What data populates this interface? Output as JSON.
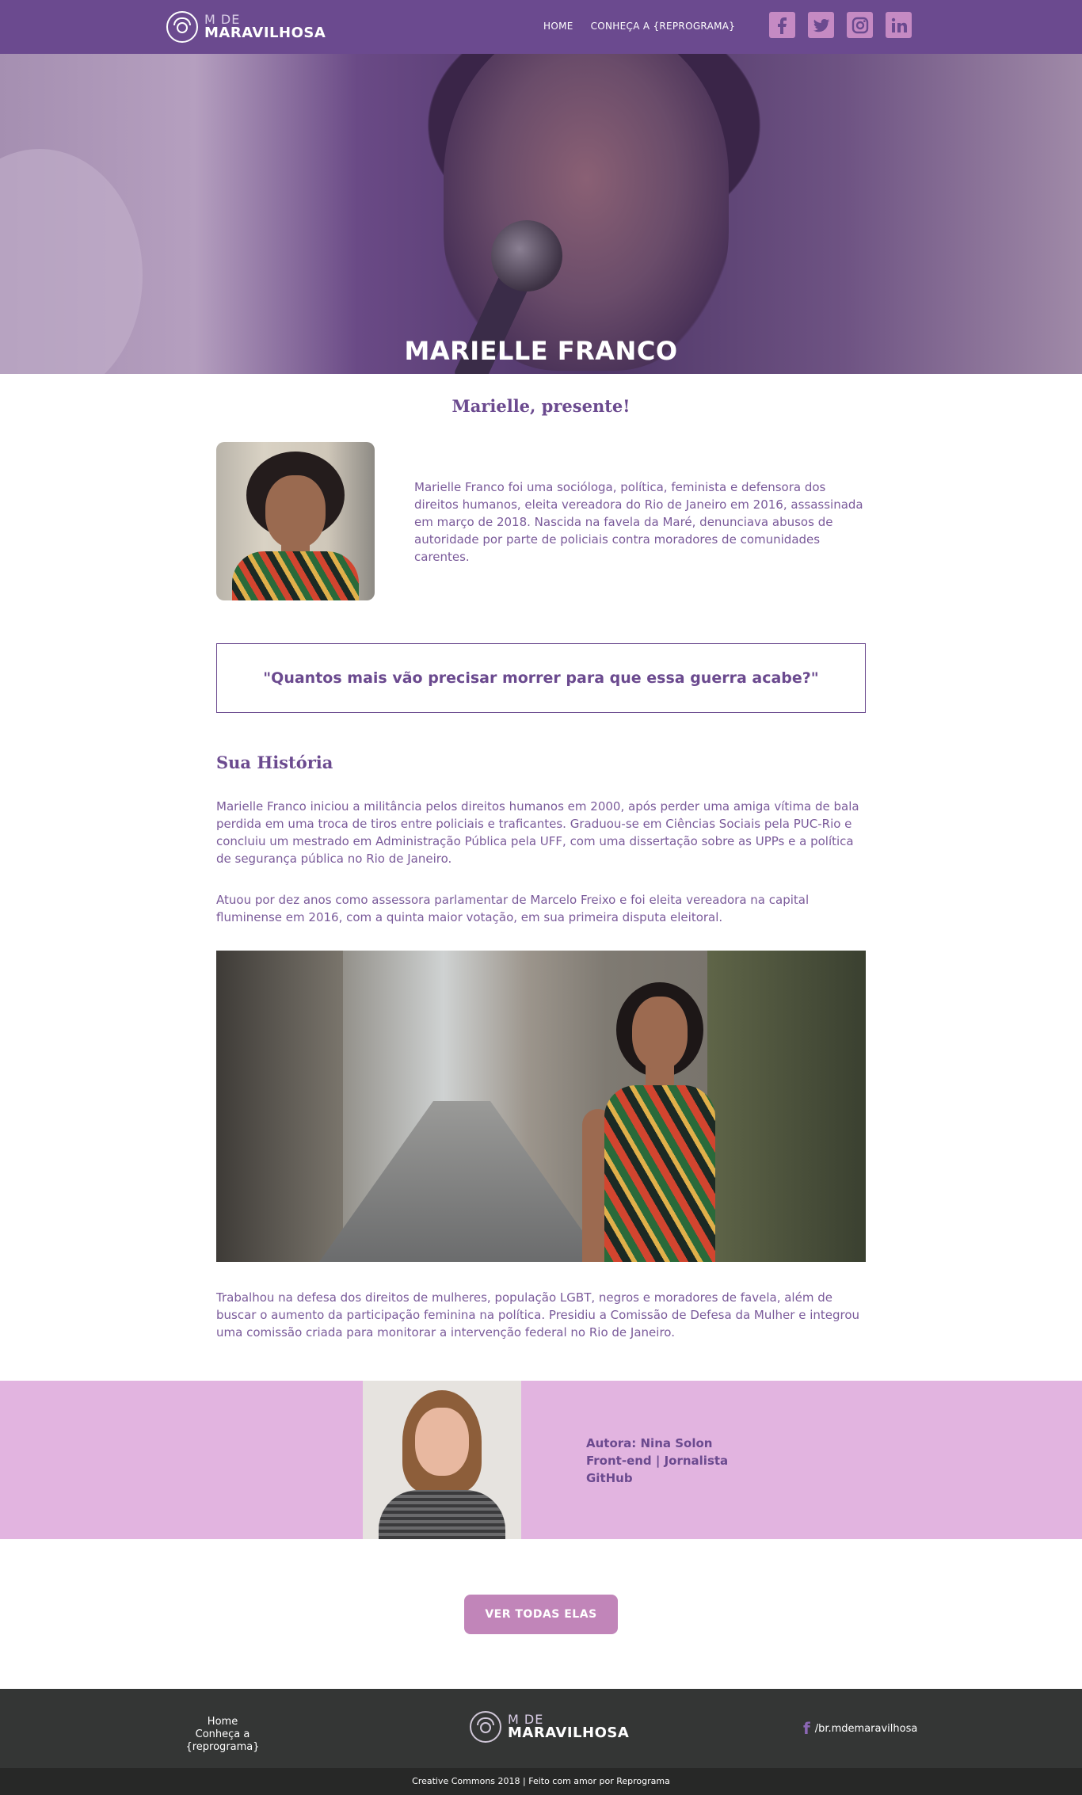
{
  "header": {
    "logo_small": "M DE",
    "logo_big": "MARAVILHOSA",
    "nav": [
      {
        "label": "HOME"
      },
      {
        "label": "CONHEÇA A {REPROGRAMA}"
      }
    ],
    "social": [
      {
        "name": "facebook-icon"
      },
      {
        "name": "twitter-icon"
      },
      {
        "name": "instagram-icon"
      },
      {
        "name": "linkedin-icon"
      }
    ]
  },
  "hero": {
    "title": "MARIELLE FRANCO"
  },
  "main": {
    "subtitle": "Marielle, presente!",
    "intro": "Marielle Franco foi uma socióloga, política, feminista e defensora dos direitos humanos, eleita vereadora do Rio de Janeiro em 2016, assassinada em março de 2018. Nascida na favela da Maré, denunciava abusos de autoridade por parte de policiais contra moradores de comunidades carentes.",
    "quote": "\"Quantos mais vão precisar morrer para que essa guerra acabe?\"",
    "history_title": "Sua História",
    "paragraph1": "Marielle Franco iniciou a militância pelos direitos humanos em 2000, após perder uma amiga vítima de bala perdida em uma troca de tiros entre policiais e traficantes. Graduou-se em Ciências Sociais pela PUC-Rio e concluiu um mestrado em Administração Pública pela UFF, com uma dissertação sobre as UPPs e a política de segurança pública no Rio de Janeiro.",
    "paragraph2": "Atuou por dez anos como assessora parlamentar de Marcelo Freixo e foi eleita vereadora na capital fluminense em 2016, com a quinta maior votação, em sua primeira disputa eleitoral.",
    "paragraph3": "Trabalhou na defesa dos direitos de mulheres, população LGBT, negros e moradores de favela, além de buscar o aumento da participação feminina na política. Presidiu a Comissão de Defesa da Mulher e integrou uma comissão criada para monitorar a intervenção federal no Rio de Janeiro."
  },
  "author": {
    "name": "Autora: Nina Solon",
    "role": "Front-end | Jornalista",
    "link": "GitHub"
  },
  "cta": {
    "label": "VER TODAS ELAS"
  },
  "footer": {
    "links": [
      {
        "label": "Home"
      },
      {
        "label": "Conheça a {reprograma}"
      }
    ],
    "logo_small": "M DE",
    "logo_big": "MARAVILHOSA",
    "facebook": "/br.mdemaravilhosa",
    "copyright": "Creative Commons 2018 | Feito com amor por Reprograma"
  },
  "colors": {
    "primary": "#6b4a8f",
    "accent": "#c185b9",
    "author_bg": "#e2b4e0",
    "footer_bg": "#343635"
  }
}
